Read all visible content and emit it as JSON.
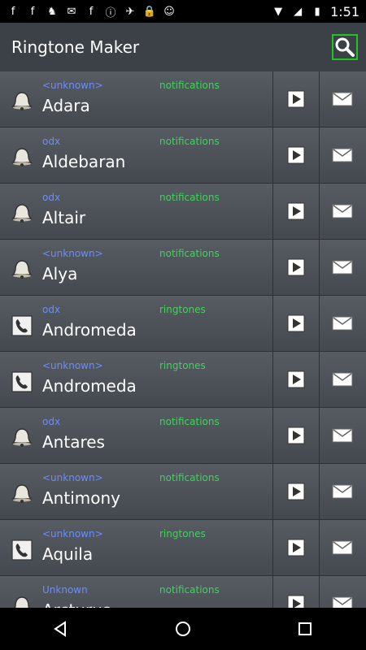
{
  "status": {
    "time": "1:51",
    "icons": [
      "facebook-icon",
      "facebook-icon",
      "cat-icon",
      "mail-icon",
      "facebook-icon",
      "info-icon",
      "satellite-icon",
      "lock-icon",
      "android-icon"
    ],
    "right_icons": [
      "wifi-icon",
      "signal-icon",
      "battery-icon"
    ]
  },
  "appbar": {
    "title": "Ringtone Maker"
  },
  "rows": [
    {
      "artist": "<unknown>",
      "type": "notifications",
      "name": "Adara",
      "icon": "bell"
    },
    {
      "artist": "odx",
      "type": "notifications",
      "name": "Aldebaran",
      "icon": "bell"
    },
    {
      "artist": "odx",
      "type": "notifications",
      "name": "Altair",
      "icon": "bell"
    },
    {
      "artist": "<unknown>",
      "type": "notifications",
      "name": "Alya",
      "icon": "bell"
    },
    {
      "artist": "odx",
      "type": "ringtones",
      "name": "Andromeda",
      "icon": "phone"
    },
    {
      "artist": "<unknown>",
      "type": "ringtones",
      "name": "Andromeda",
      "icon": "phone"
    },
    {
      "artist": "odx",
      "type": "notifications",
      "name": "Antares",
      "icon": "bell"
    },
    {
      "artist": "<unknown>",
      "type": "notifications",
      "name": "Antimony",
      "icon": "bell"
    },
    {
      "artist": "<unknown>",
      "type": "ringtones",
      "name": "Aquila",
      "icon": "phone"
    },
    {
      "artist": "Unknown",
      "type": "notifications",
      "name": "Arcturus",
      "icon": "bell"
    }
  ],
  "colors": {
    "accent": "#21c521",
    "artist": "#6a8cff",
    "type": "#3fd35b"
  }
}
